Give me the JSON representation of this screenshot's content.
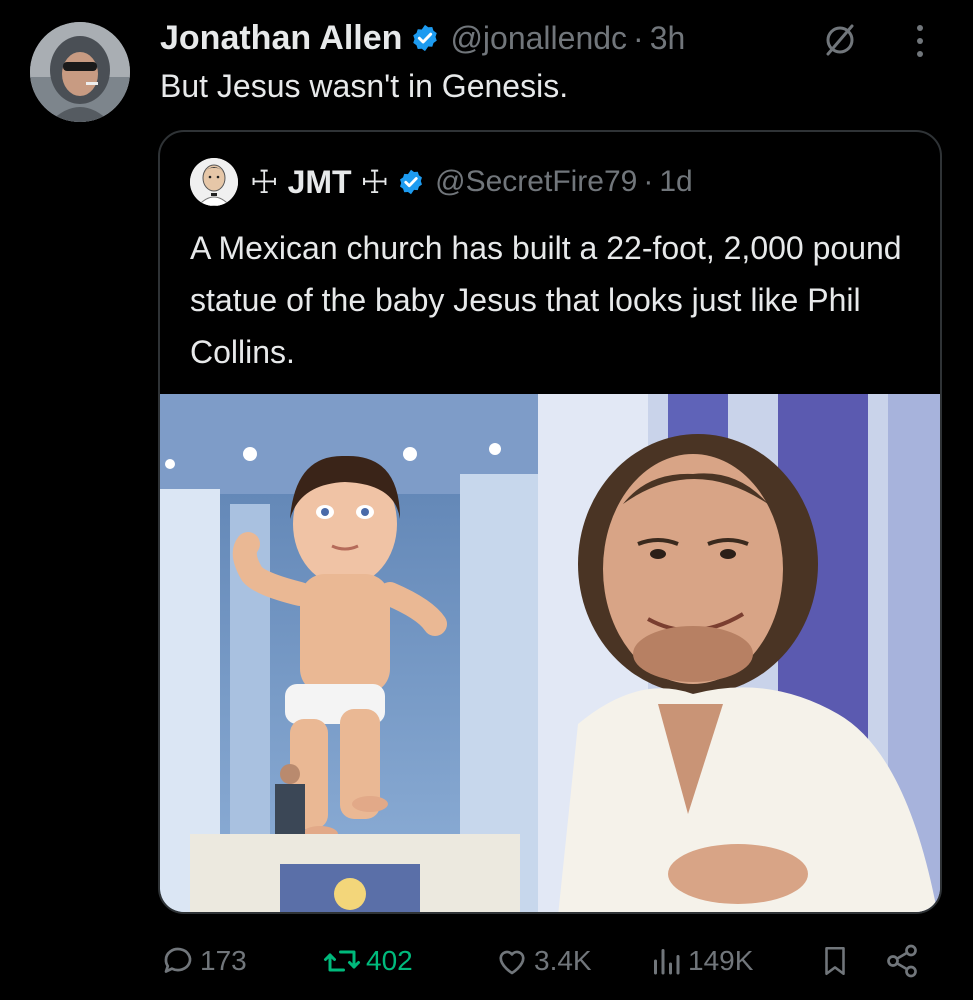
{
  "tweet": {
    "display_name": "Jonathan Allen",
    "handle": "@jonallendc",
    "separator": "·",
    "time": "3h",
    "text": "But Jesus wasn't in Genesis.",
    "avatar_icon": "user-avatar-hoodie-sunglasses"
  },
  "quoted": {
    "display_name": "☩ JMT ☩",
    "handle": "@SecretFire79",
    "separator": "·",
    "time": "1d",
    "text": "A Mexican church has built a 22-foot, 2,000 pound statue of the baby Jesus that looks just like Phil Collins.",
    "media": [
      {
        "icon": "baby-jesus-statue-photo"
      },
      {
        "icon": "phil-collins-photo"
      }
    ]
  },
  "actions": {
    "replies": "173",
    "reposts": "402",
    "likes": "3.4K",
    "views": "149K"
  },
  "colors": {
    "background": "#000000",
    "text": "#e7e9ea",
    "muted": "#71767b",
    "verified": "#1d9bf0",
    "repost_active": "#00ba7c",
    "border": "#2f3336"
  }
}
